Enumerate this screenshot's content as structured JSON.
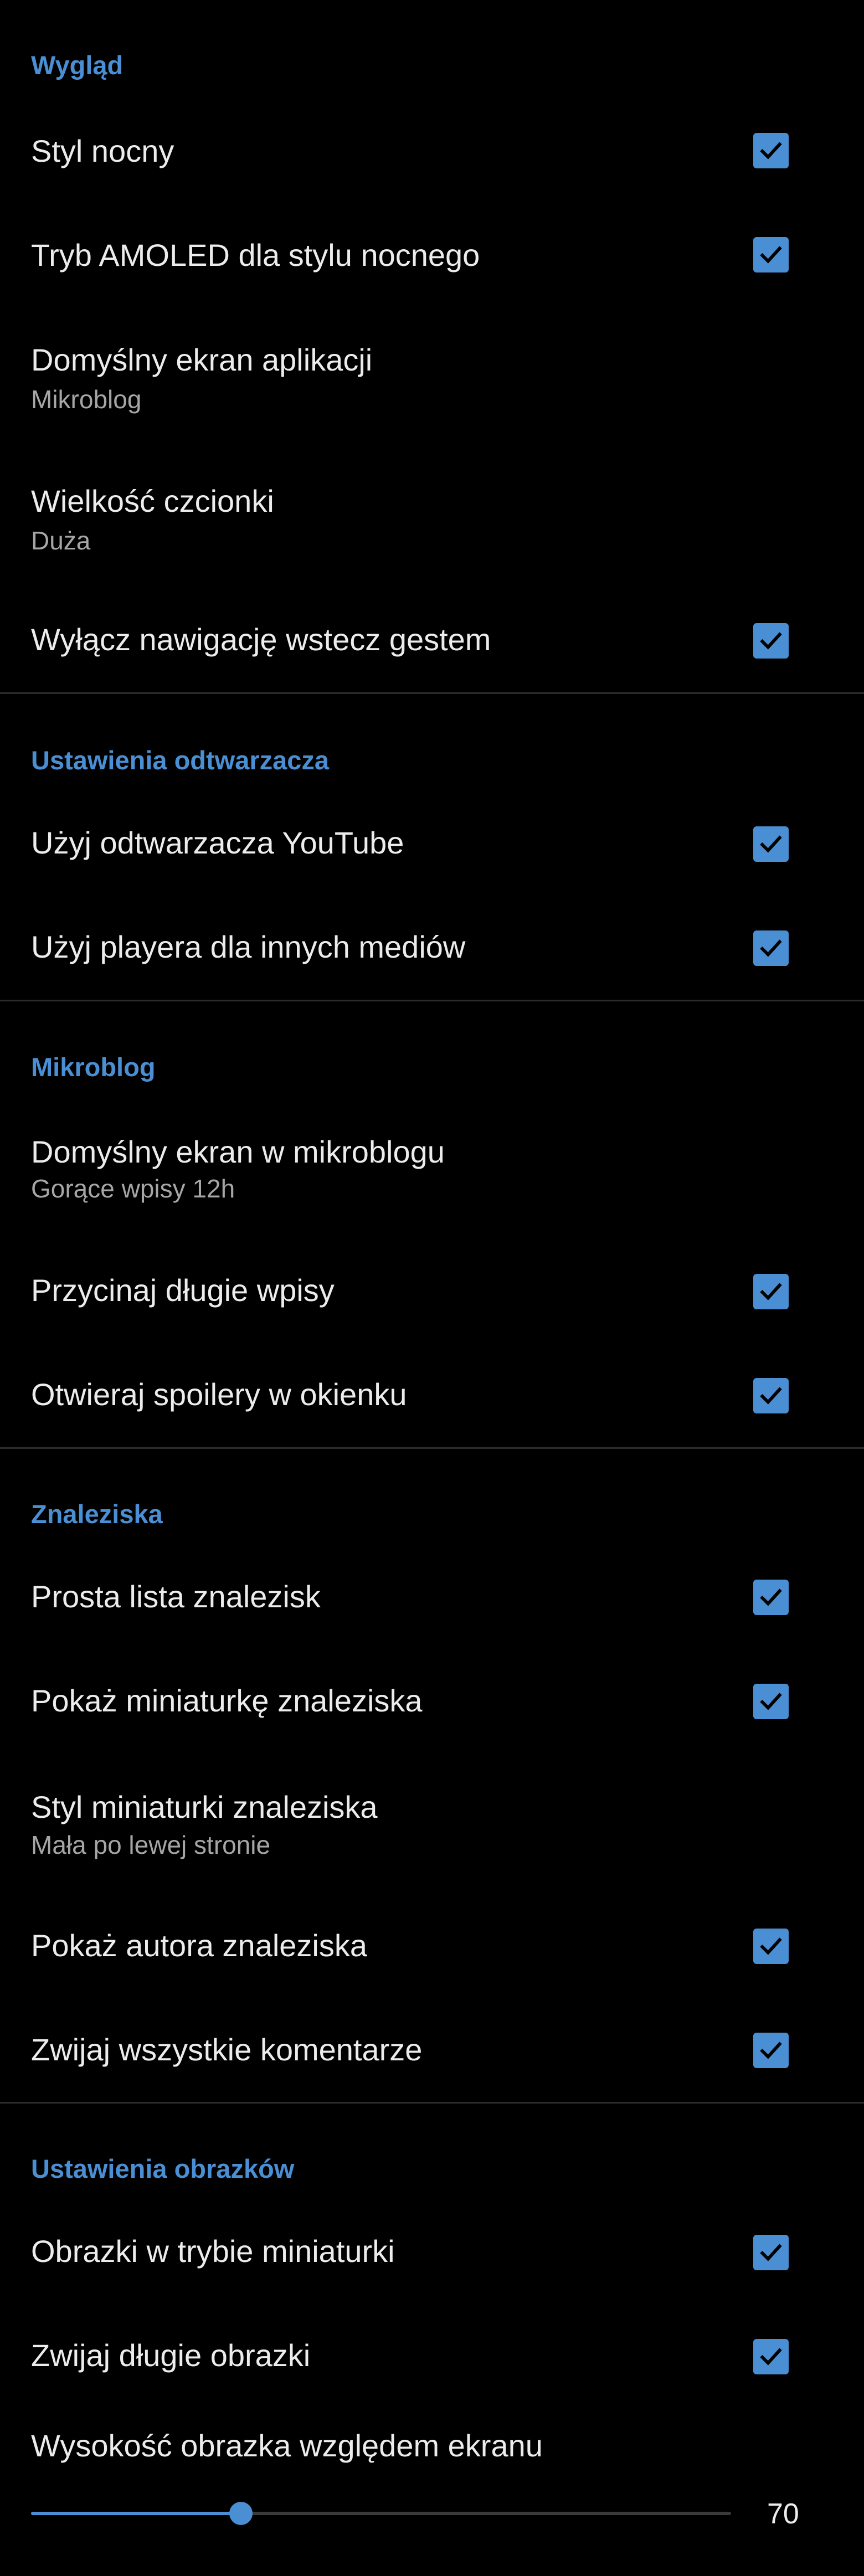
{
  "accent_color": "#4a8fd4",
  "sections": {
    "appearance": {
      "title": "Wygląd",
      "night_style": "Styl nocny",
      "amoled": "Tryb AMOLED dla stylu nocnego",
      "default_screen": "Domyślny ekran aplikacji",
      "default_screen_value": "Mikroblog",
      "font_size": "Wielkość czcionki",
      "font_size_value": "Duża",
      "disable_back_gesture": "Wyłącz nawigację wstecz gestem"
    },
    "player": {
      "title": "Ustawienia odtwarzacza",
      "youtube_player": "Użyj odtwarzacza YouTube",
      "other_media_player": "Użyj playera dla innych mediów"
    },
    "microblog": {
      "title": "Mikroblog",
      "default_screen": "Domyślny ekran w mikroblogu",
      "default_screen_value": "Gorące wpisy 12h",
      "truncate_long": "Przycinaj długie wpisy",
      "spoilers_popup": "Otwieraj spoilery w okienku"
    },
    "links": {
      "title": "Znaleziska",
      "simple_list": "Prosta lista znalezisk",
      "show_thumbnail": "Pokaż miniaturkę znaleziska",
      "thumbnail_style": "Styl miniaturki znaleziska",
      "thumbnail_style_value": "Mała po lewej stronie",
      "show_author": "Pokaż autora znaleziska",
      "collapse_comments": "Zwijaj wszystkie komentarze"
    },
    "images": {
      "title": "Ustawienia obrazków",
      "thumbnail_mode": "Obrazki w trybie miniaturki",
      "collapse_long": "Zwijaj długie obrazki",
      "height_ratio": "Wysokość obrazka względem ekranu",
      "height_ratio_value": "70",
      "height_ratio_fraction": 0.3
    }
  },
  "checkboxes": {
    "night_style": true,
    "amoled": true,
    "disable_back_gesture": true,
    "youtube_player": true,
    "other_media_player": true,
    "truncate_long": true,
    "spoilers_popup": true,
    "simple_list": true,
    "show_thumbnail": true,
    "show_author": true,
    "collapse_comments": true,
    "thumbnail_mode": true,
    "collapse_long": true
  },
  "icons": {
    "checkbox": "check-icon"
  }
}
